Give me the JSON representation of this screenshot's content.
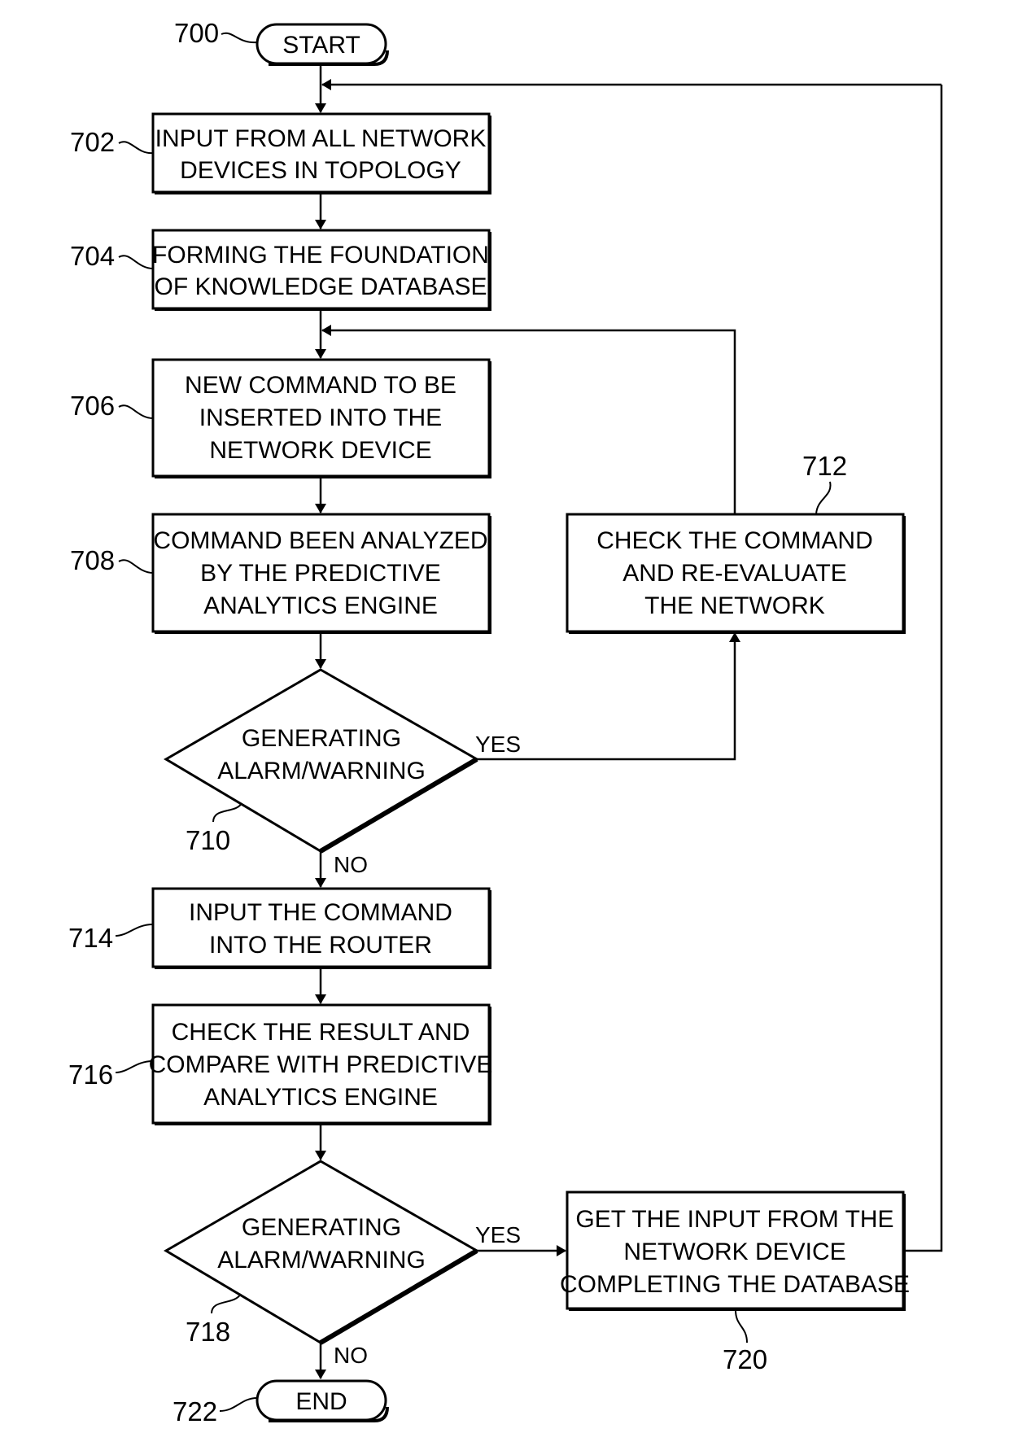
{
  "diagram": {
    "type": "flowchart",
    "figure_ref": "700",
    "start": {
      "ref": "700",
      "label": "START"
    },
    "end": {
      "ref": "722",
      "label": "END"
    },
    "steps": [
      {
        "ref": "702",
        "lines": [
          "INPUT FROM ALL NETWORK",
          "DEVICES IN TOPOLOGY"
        ]
      },
      {
        "ref": "704",
        "lines": [
          "FORMING THE FOUNDATION",
          "OF KNOWLEDGE DATABASE"
        ]
      },
      {
        "ref": "706",
        "lines": [
          "NEW COMMAND TO BE",
          "INSERTED INTO THE",
          "NETWORK DEVICE"
        ]
      },
      {
        "ref": "708",
        "lines": [
          "COMMAND BEEN ANALYZED",
          "BY THE PREDICTIVE",
          "ANALYTICS ENGINE"
        ]
      },
      {
        "ref": "712",
        "lines": [
          "CHECK THE COMMAND",
          "AND RE-EVALUATE",
          "THE NETWORK"
        ]
      },
      {
        "ref": "714",
        "lines": [
          "INPUT THE COMMAND",
          "INTO THE ROUTER"
        ]
      },
      {
        "ref": "716",
        "lines": [
          "CHECK THE RESULT AND",
          "COMPARE WITH PREDICTIVE",
          "ANALYTICS ENGINE"
        ]
      },
      {
        "ref": "720",
        "lines": [
          "GET THE INPUT FROM THE",
          "NETWORK DEVICE",
          "COMPLETING THE DATABASE"
        ]
      }
    ],
    "decisions": [
      {
        "ref": "710",
        "lines": [
          "GENERATING",
          "ALARM/WARNING"
        ],
        "yes": "YES",
        "no": "NO"
      },
      {
        "ref": "718",
        "lines": [
          "GENERATING",
          "ALARM/WARNING"
        ],
        "yes": "YES",
        "no": "NO"
      }
    ],
    "edges": [
      {
        "from": "700",
        "to": "702"
      },
      {
        "from": "702",
        "to": "704"
      },
      {
        "from": "704",
        "to": "706"
      },
      {
        "from": "706",
        "to": "708"
      },
      {
        "from": "708",
        "to": "710"
      },
      {
        "from": "710",
        "to": "712",
        "label": "YES"
      },
      {
        "from": "712",
        "to": "706"
      },
      {
        "from": "710",
        "to": "714",
        "label": "NO"
      },
      {
        "from": "714",
        "to": "716"
      },
      {
        "from": "716",
        "to": "718"
      },
      {
        "from": "718",
        "to": "720",
        "label": "YES"
      },
      {
        "from": "720",
        "to": "702"
      },
      {
        "from": "718",
        "to": "722",
        "label": "NO"
      }
    ]
  }
}
